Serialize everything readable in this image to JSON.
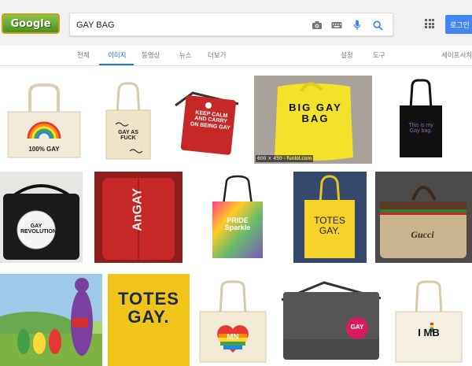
{
  "search": {
    "query": "GAY BAG",
    "logo_text": "Google"
  },
  "header": {
    "login_label": "로그인"
  },
  "tabs": [
    {
      "label": "전체"
    },
    {
      "label": "이미지"
    },
    {
      "label": "동영상"
    },
    {
      "label": "뉴스"
    },
    {
      "label": "더보기"
    }
  ],
  "tools": {
    "settings": "설정",
    "tools": "도구",
    "safesearch": "세이프서치"
  },
  "results": [
    {
      "bag_text": "100% GAY"
    },
    {
      "bag_text": "GAY AS FUCK"
    },
    {
      "bag_text": "KEEP CALM AND CARRY ON BEING GAY"
    },
    {
      "bag_text": "BIG GAY BAG",
      "caption": "600 × 450 - funlol.com"
    },
    {
      "bag_text": "This is my Gay bag."
    },
    {
      "bag_text": "GAY REVOLUTION"
    },
    {
      "bag_text": "AnGAY"
    },
    {
      "bag_text": "PRIDE Sparkle"
    },
    {
      "bag_text": "TOTES GAY."
    },
    {
      "bag_text": "Gucci"
    },
    {
      "bag_text": ""
    },
    {
      "bag_text": "TOTES GAY."
    },
    {
      "bag_text": "MN"
    },
    {
      "bag_text": "GAY"
    },
    {
      "bag_text": "I MB"
    }
  ],
  "colors": {
    "accent": "#1a73e8",
    "login": "#4285f4"
  }
}
